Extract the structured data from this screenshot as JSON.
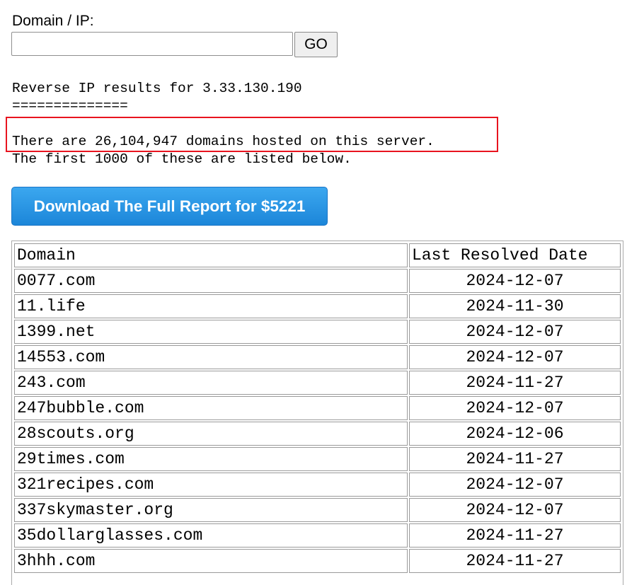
{
  "form": {
    "label": "Domain / IP:",
    "input_value": "",
    "input_placeholder": "",
    "go_label": "GO"
  },
  "results": {
    "heading": "Reverse IP results for 3.33.130.190",
    "underline": "==============",
    "count_line": "There are 26,104,947 domains hosted on this server.",
    "sub_line": "The first 1000 of these are listed below.",
    "highlight_color": "#e8141f"
  },
  "download": {
    "label": "Download The Full Report for $5221",
    "color": "#1c86d9"
  },
  "table": {
    "headers": [
      "Domain",
      "Last Resolved Date"
    ],
    "rows": [
      {
        "domain": "0077.com",
        "date": "2024-12-07"
      },
      {
        "domain": "11.life",
        "date": "2024-11-30"
      },
      {
        "domain": "1399.net",
        "date": "2024-12-07"
      },
      {
        "domain": "14553.com",
        "date": "2024-12-07"
      },
      {
        "domain": "243.com",
        "date": "2024-11-27"
      },
      {
        "domain": "247bubble.com",
        "date": "2024-12-07"
      },
      {
        "domain": "28scouts.org",
        "date": "2024-12-06"
      },
      {
        "domain": "29times.com",
        "date": "2024-11-27"
      },
      {
        "domain": "321recipes.com",
        "date": "2024-12-07"
      },
      {
        "domain": "337skymaster.org",
        "date": "2024-12-07"
      },
      {
        "domain": "35dollarglasses.com",
        "date": "2024-11-27"
      },
      {
        "domain": "3hhh.com",
        "date": "2024-11-27"
      }
    ]
  }
}
